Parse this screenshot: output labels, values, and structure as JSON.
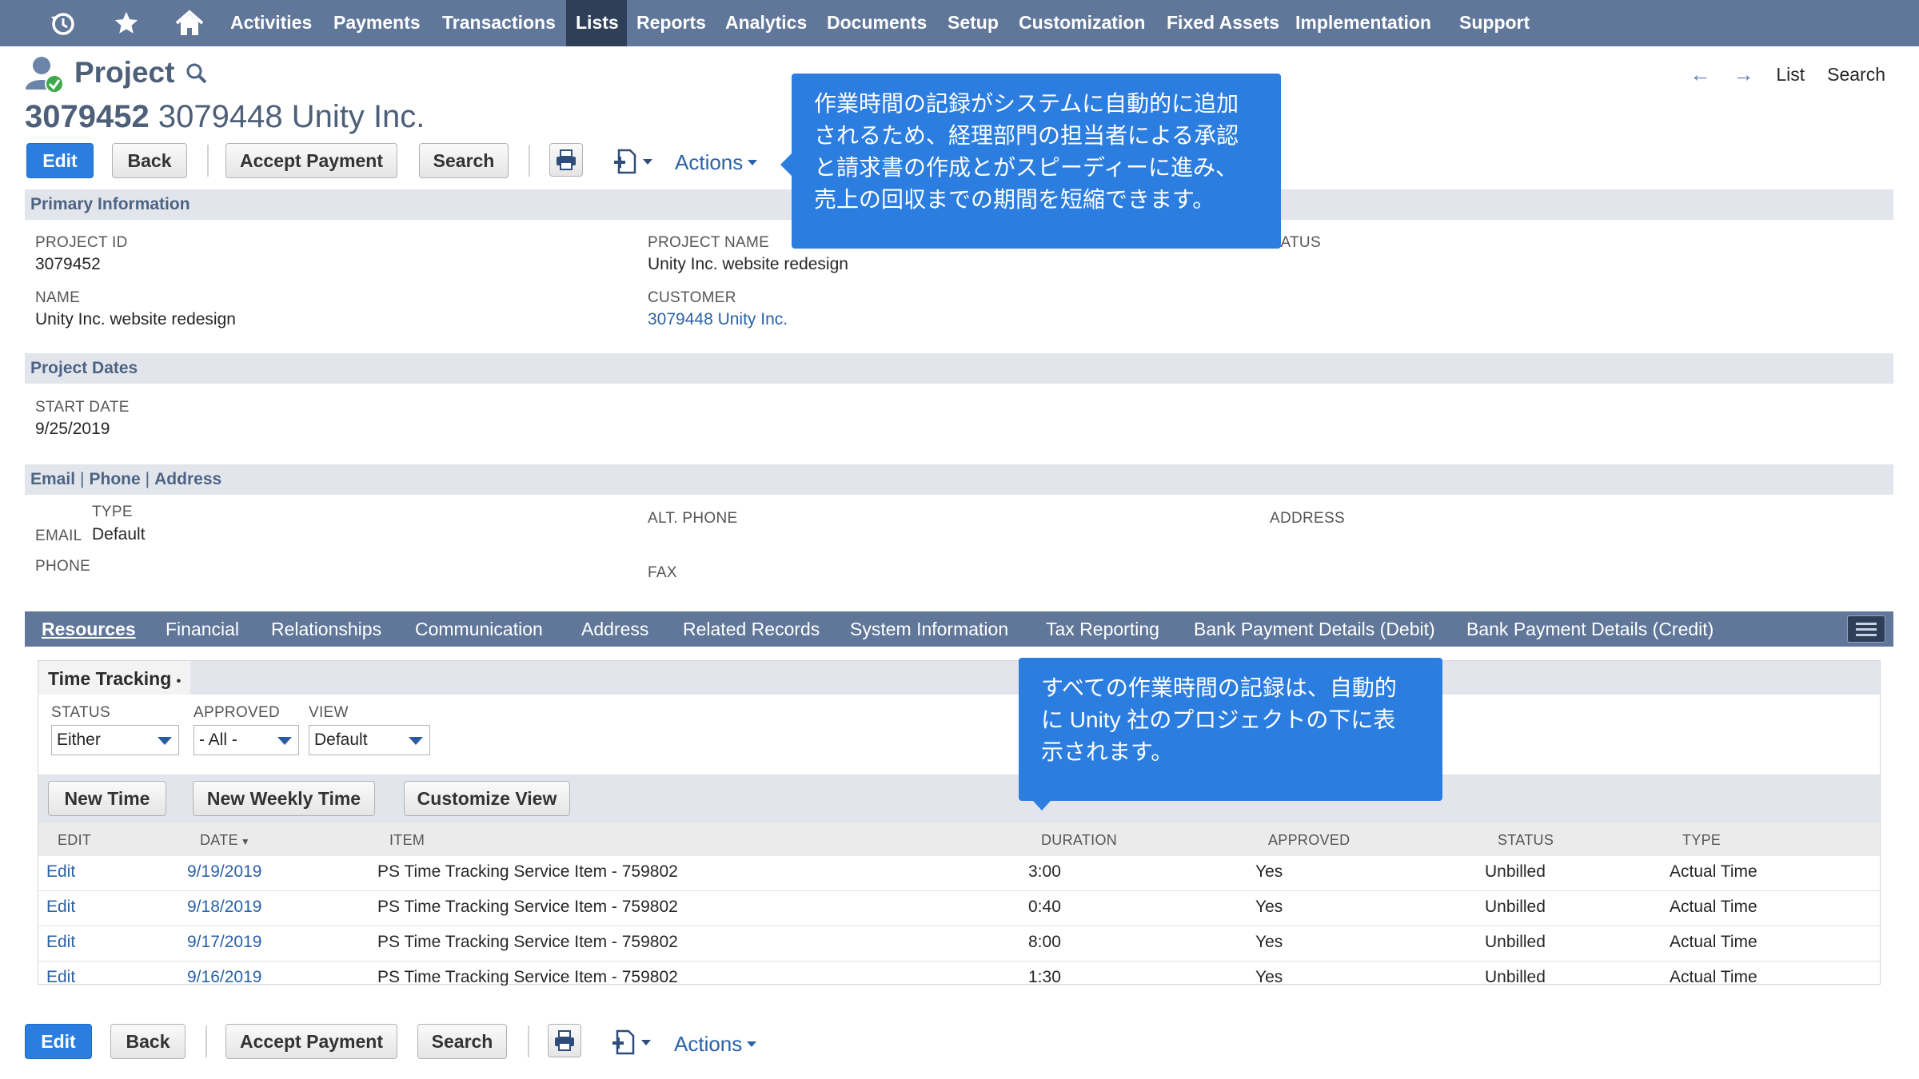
{
  "nav": {
    "icons": [
      "recent-icon",
      "star-icon",
      "home-icon"
    ],
    "items": [
      "Activities",
      "Payments",
      "Transactions",
      "Lists",
      "Reports",
      "Analytics",
      "Documents",
      "Setup",
      "Customization",
      "Fixed Assets",
      "Implementation",
      "Support"
    ],
    "active": "Lists"
  },
  "header": {
    "record_type": "Project",
    "record_number": "3079452",
    "record_name": "3079448 Unity Inc.",
    "links": {
      "list": "List",
      "search": "Search"
    }
  },
  "toolbar": {
    "edit": "Edit",
    "back": "Back",
    "accept_payment": "Accept Payment",
    "search": "Search",
    "actions": "Actions"
  },
  "primary": {
    "title": "Primary Information",
    "project_id_label": "PROJECT ID",
    "project_id": "3079452",
    "name_label": "NAME",
    "name": "Unity Inc. website redesign",
    "project_name_label": "PROJECT NAME",
    "project_name": "Unity Inc. website redesign",
    "customer_label": "CUSTOMER",
    "customer": "3079448 Unity Inc.",
    "status_label": "STATUS"
  },
  "dates": {
    "title": "Project Dates",
    "start_date_label": "START DATE",
    "start_date": "9/25/2019"
  },
  "contact": {
    "title_email": "Email",
    "title_phone": "Phone",
    "title_address": "Address",
    "separator": "|",
    "type_label": "TYPE",
    "email_label": "EMAIL",
    "type_value": "Default",
    "phone_label": "PHONE",
    "alt_phone_label": "ALT. PHONE",
    "fax_label": "FAX",
    "address_label": "ADDRESS"
  },
  "subtabs": [
    "Resources",
    "Financial",
    "Relationships",
    "Communication",
    "Address",
    "Related Records",
    "System Information",
    "Tax Reporting",
    "Bank Payment Details (Debit)",
    "Bank Payment Details (Credit)"
  ],
  "time_tracking": {
    "title": "Time Tracking",
    "marker": "•",
    "filters": {
      "status_label": "STATUS",
      "status_value": "Either",
      "approved_label": "APPROVED",
      "approved_value": "- All -",
      "view_label": "VIEW",
      "view_value": "Default"
    },
    "buttons": {
      "new_time": "New Time",
      "new_weekly_time": "New Weekly Time",
      "customize_view": "Customize View"
    },
    "columns": [
      "EDIT",
      "DATE",
      "ITEM",
      "DURATION",
      "APPROVED",
      "STATUS",
      "TYPE"
    ],
    "rows": [
      {
        "edit": "Edit",
        "date": "9/19/2019",
        "item": "PS Time Tracking Service Item - 759802",
        "duration": "3:00",
        "approved": "Yes",
        "status": "Unbilled",
        "type": "Actual Time"
      },
      {
        "edit": "Edit",
        "date": "9/18/2019",
        "item": "PS Time Tracking Service Item - 759802",
        "duration": "0:40",
        "approved": "Yes",
        "status": "Unbilled",
        "type": "Actual Time"
      },
      {
        "edit": "Edit",
        "date": "9/17/2019",
        "item": "PS Time Tracking Service Item - 759802",
        "duration": "8:00",
        "approved": "Yes",
        "status": "Unbilled",
        "type": "Actual Time"
      },
      {
        "edit": "Edit",
        "date": "9/16/2019",
        "item": "PS Time Tracking Service Item - 759802",
        "duration": "1:30",
        "approved": "Yes",
        "status": "Unbilled",
        "type": "Actual Time"
      }
    ]
  },
  "callouts": {
    "top": [
      "作業時間の記録がシステムに自動的に追加",
      "されるため、経理部門の担当者による承認",
      "と請求書の作成とがスピーディーに進み、",
      "売上の回収までの期間を短縮できます。"
    ],
    "bottom": [
      "すべての作業時間の記録は、自動的",
      "に Unity 社のプロジェクトの下に表",
      "示されます。"
    ]
  },
  "colors": {
    "nav_bg": "#607799",
    "nav_active": "#2e3f57",
    "primary_button": "#2c7de0",
    "link": "#2a62a8",
    "section_bg": "#e2e6ec",
    "callout_bg": "#2c7de0"
  }
}
